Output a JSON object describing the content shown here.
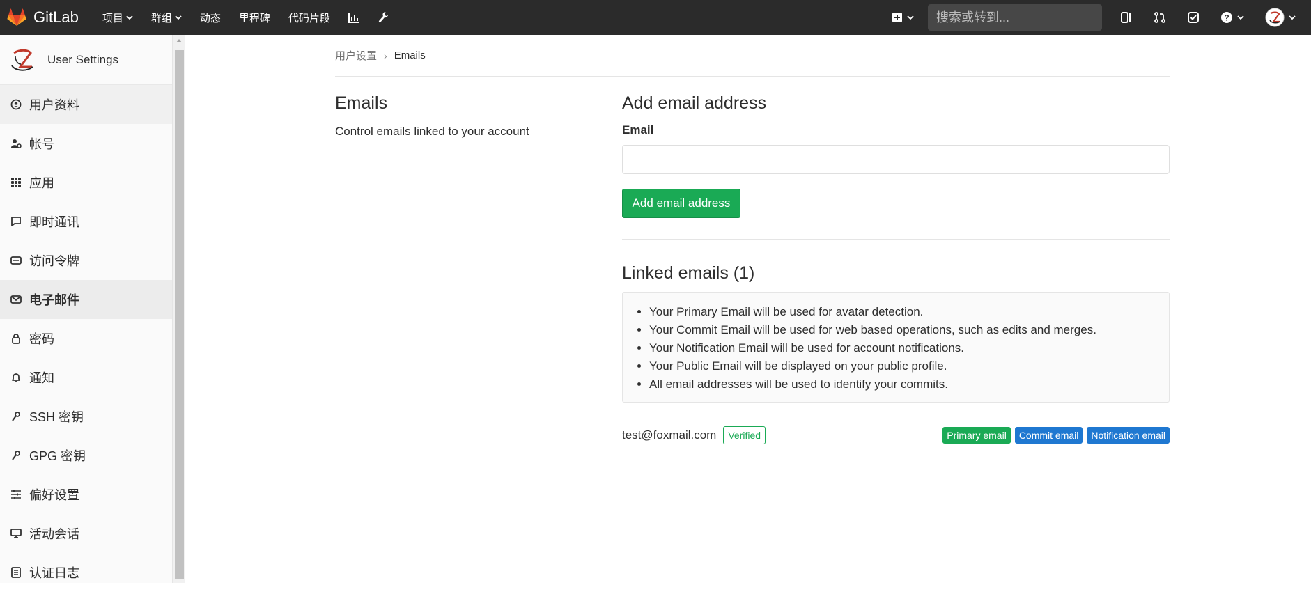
{
  "navbar": {
    "brand": "GitLab",
    "links": [
      {
        "label": "项目",
        "dropdown": true
      },
      {
        "label": "群组",
        "dropdown": true
      },
      {
        "label": "动态",
        "dropdown": false
      },
      {
        "label": "里程碑",
        "dropdown": false
      },
      {
        "label": "代码片段",
        "dropdown": false
      }
    ],
    "search_placeholder": "搜索或转到...",
    "icons": [
      "plus-square-icon",
      "chevron-down-icon",
      "search-icon",
      "sidebar-icon",
      "merge-request-icon",
      "todo-icon",
      "help-icon",
      "user-avatar-icon"
    ]
  },
  "sidebar": {
    "title": "User Settings",
    "items": [
      {
        "label": "用户资料",
        "icon": "profile-icon"
      },
      {
        "label": "帐号",
        "icon": "account-icon"
      },
      {
        "label": "应用",
        "icon": "applications-icon"
      },
      {
        "label": "即时通讯",
        "icon": "chat-icon"
      },
      {
        "label": "访问令牌",
        "icon": "token-icon"
      },
      {
        "label": "电子邮件",
        "icon": "mail-icon"
      },
      {
        "label": "密码",
        "icon": "lock-icon"
      },
      {
        "label": "通知",
        "icon": "bell-icon"
      },
      {
        "label": "SSH 密钥",
        "icon": "key-icon"
      },
      {
        "label": "GPG 密钥",
        "icon": "key-icon"
      },
      {
        "label": "偏好设置",
        "icon": "preferences-icon"
      },
      {
        "label": "活动会话",
        "icon": "monitor-icon"
      },
      {
        "label": "认证日志",
        "icon": "log-icon"
      }
    ],
    "active_index": 5,
    "hover_index": 0
  },
  "breadcrumb": {
    "parent": "用户设置",
    "current": "Emails"
  },
  "emails": {
    "section_title": "Emails",
    "section_desc": "Control emails linked to your account",
    "add_title": "Add email address",
    "email_label": "Email",
    "email_value": "",
    "add_button": "Add email address",
    "linked_title": "Linked emails (1)",
    "info_items": [
      "Your Primary Email will be used for avatar detection.",
      "Your Commit Email will be used for web based operations, such as edits and merges.",
      "Your Notification Email will be used for account notifications.",
      "Your Public Email will be displayed on your public profile.",
      "All email addresses will be used to identify your commits."
    ],
    "list": [
      {
        "address": "test@foxmail.com",
        "status": "Verified",
        "badges": [
          {
            "label": "Primary email",
            "color": "#1aaa55"
          },
          {
            "label": "Commit email",
            "color": "#1f78d1"
          },
          {
            "label": "Notification email",
            "color": "#1f78d1"
          }
        ]
      }
    ]
  },
  "colors": {
    "navbar_bg": "#2b2b2b",
    "success": "#1aaa55",
    "info": "#1f78d1",
    "gitlab_orange": "#fc6d26"
  }
}
